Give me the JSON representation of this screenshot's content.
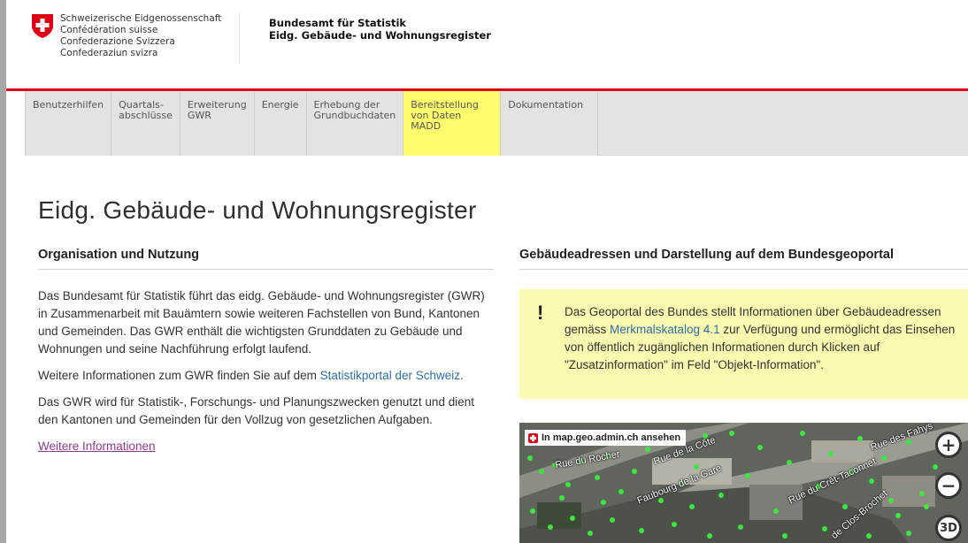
{
  "header": {
    "confederation_lines": [
      "Schweizerische Eidgenossenschaft",
      "Confédération suisse",
      "Confederazione Svizzera",
      "Confederaziun svizra"
    ],
    "office_line1": "Bundesamt für Statistik",
    "office_line2": "Eidg. Gebäude- und Wohnungsregister"
  },
  "nav": {
    "items": [
      {
        "label": "Benutzerhilfen"
      },
      {
        "label": "Quartals-\nabschlüsse"
      },
      {
        "label": "Erweiterung\nGWR"
      },
      {
        "label": "Energie"
      },
      {
        "label": "Erhebung der\nGrundbuchdaten"
      },
      {
        "label": "Bereitstellung\nvon Daten\nMADD",
        "active": true
      },
      {
        "label": "Dokumentation"
      }
    ]
  },
  "main": {
    "title": "Eidg. Gebäude- und Wohnungsregister",
    "left": {
      "heading": "Organisation und Nutzung",
      "p1": "Das Bundesamt für Statistik führt das eidg. Gebäude- und Wohnungsregister (GWR) in Zusammenarbeit mit Bauämtern sowie weiteren Fachstellen von Bund, Kantonen und Gemeinden. Das GWR enthält die wichtigsten Grunddaten zu Gebäude und Wohnungen und seine Nachführung erfolgt laufend.",
      "p2_prefix": "Weitere Informationen zum GWR finden Sie auf dem ",
      "p2_link": "Statistikportal der Schweiz",
      "p2_suffix": ".",
      "p3": "Das GWR wird für Statistik-, Forschungs- und Planungszwecken genutzt und dient den Kantonen und Gemeinden für den Vollzug von gesetzlichen Aufgaben.",
      "more_link": "Weitere Informationen"
    },
    "right": {
      "heading": "Gebäudeadressen und Darstellung auf dem Bundesgeoportal",
      "notice_mark": "!",
      "notice_prefix": "Das Geoportal des Bundes stellt Informationen über Gebäudeadressen gemäss ",
      "notice_link": "Merkmalskatalog 4.1",
      "notice_suffix": " zur Verfügung und ermöglicht das Einsehen von öffentlich zugänglichen Informationen durch Klicken auf \"Zusatzinformation\" im Feld \"Objekt-Information\".",
      "map_badge": "In map.geo.admin.ch ansehen",
      "zoom_in": "+",
      "zoom_out": "−",
      "map_3d": "3D",
      "street_labels": [
        "Rue du Rocher",
        "Rue de la Côte",
        "Faubourg de la Gare",
        "Rue du Crêt-Taconnet",
        "Rue des Fahys",
        "de Clos-Brochet"
      ]
    }
  },
  "colors": {
    "swiss_red": "#dc0018",
    "nav_active": "#ffff6e",
    "notice_bg": "#fafab0",
    "link": "#2f6ea5",
    "visited_link": "#8a3e8a"
  }
}
